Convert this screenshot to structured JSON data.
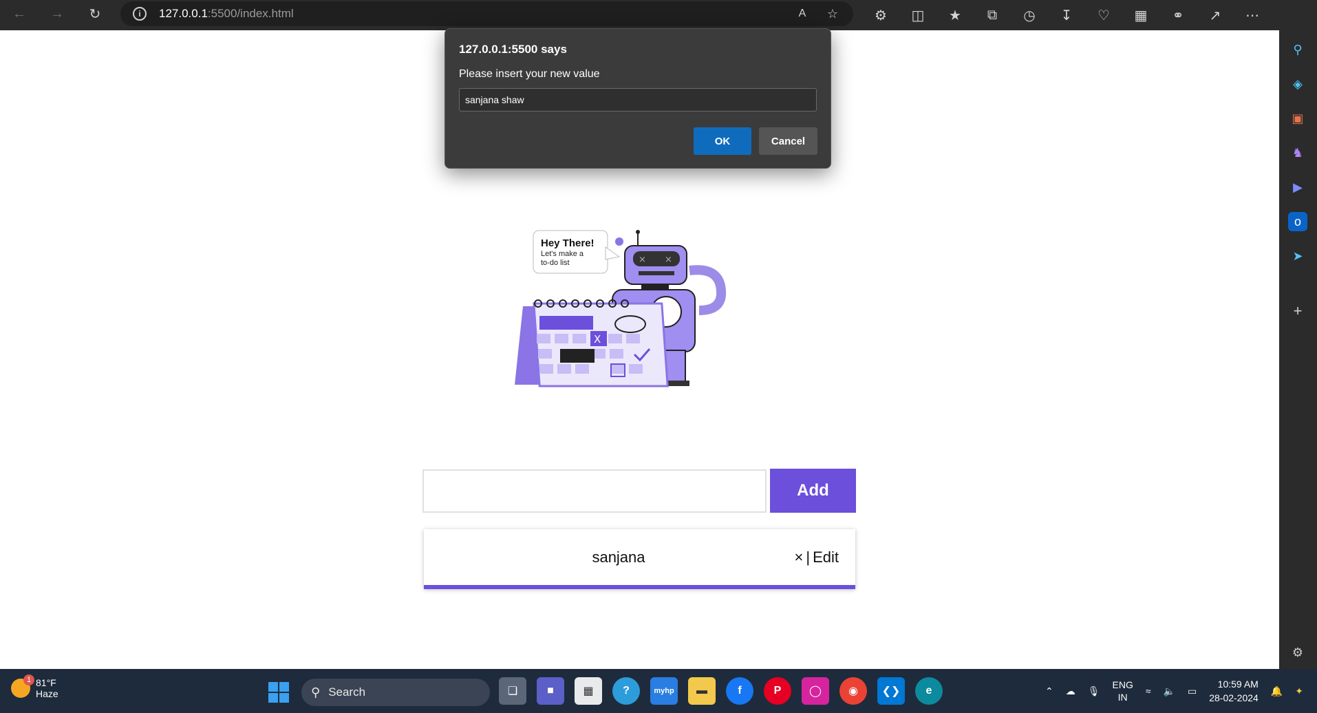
{
  "browser": {
    "url_host": "127.0.0.1",
    "url_path": ":5500/index.html"
  },
  "dialog": {
    "title": "127.0.0.1:5500 says",
    "message": "Please insert your new value",
    "input_value": "sanjana shaw",
    "ok_label": "OK",
    "cancel_label": "Cancel"
  },
  "illustration": {
    "bubble_title": "Hey There!",
    "bubble_line1": "Let's make a",
    "bubble_line2": "to-do list"
  },
  "todo": {
    "add_label": "Add",
    "input_value": "",
    "items": [
      {
        "text": "sanjana",
        "delete_label": "×",
        "separator": "|",
        "edit_label": "Edit"
      }
    ]
  },
  "taskbar": {
    "weather_temp": "81°F",
    "weather_desc": "Haze",
    "notification_count": "1",
    "search_label": "Search",
    "lang_top": "ENG",
    "lang_bottom": "IN",
    "time": "10:59 AM",
    "date": "28-02-2024",
    "myhp_label": "myhp"
  },
  "colors": {
    "accent": "#6c4fdb",
    "dialog_ok": "#0f6cbd"
  }
}
